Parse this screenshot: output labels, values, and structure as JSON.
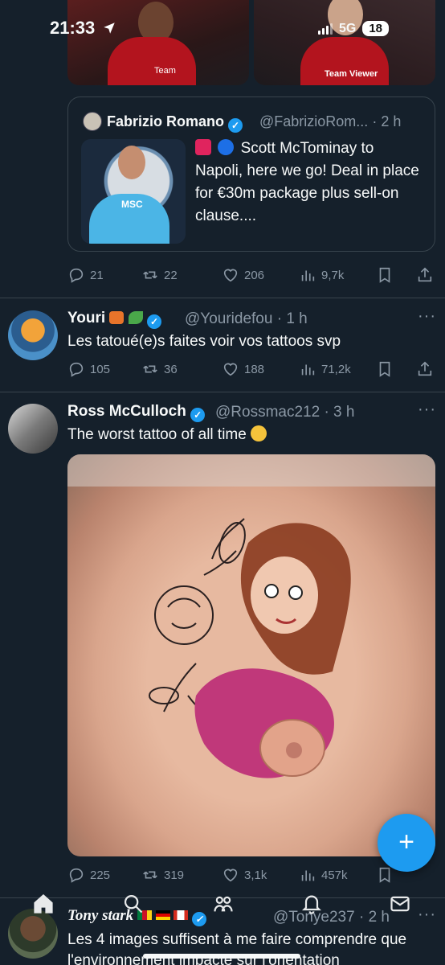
{
  "status_bar": {
    "time": "21:33",
    "network": "5G",
    "battery": "18"
  },
  "quoted_tweet": {
    "name": "Fabrizio Romano",
    "handle": "@FabrizioRom...",
    "age": "· 2 h",
    "text": "Scott McTominay to Napoli, here we go! Deal in place for €30m package plus sell-on clause....",
    "thumbnail_text": "MSC"
  },
  "top_photo_text": {
    "left_sponsor": "Team",
    "right_sponsor": "Team Viewer"
  },
  "tweet1_actions": {
    "replies": "21",
    "retweets": "22",
    "likes": "206",
    "views": "9,7k"
  },
  "tweet2": {
    "name": "Youri",
    "handle": "@Youridefou",
    "age": "· 1 h",
    "text": "Les tatoué(e)s faites voir vos tattoos svp",
    "actions": {
      "replies": "105",
      "retweets": "36",
      "likes": "188",
      "views": "71,2k"
    }
  },
  "tweet3": {
    "name": "Ross McCulloch",
    "handle": "@Rossmac212",
    "age": "· 3 h",
    "text": "The worst tattoo of all time",
    "actions": {
      "replies": "225",
      "retweets": "319",
      "likes": "3,1k",
      "views": "457k"
    }
  },
  "tweet4": {
    "name": "Tony stark",
    "handle": "@Tonye237",
    "age": "· 2 h",
    "text_line1": "Les 4 images suffisent à me faire comprendre que",
    "text_line2": "l'environnement impacte sur l'orientation"
  },
  "fab_label": "+",
  "colors": {
    "background": "#15202b",
    "accent": "#1d9bf0",
    "muted": "#8b98a5",
    "divider": "#38444d"
  },
  "icons": [
    "location-arrow-icon",
    "signal-icon",
    "verified-badge-icon",
    "reply-icon",
    "retweet-icon",
    "like-icon",
    "views-icon",
    "bookmark-icon",
    "share-icon",
    "more-icon",
    "home-icon",
    "search-icon",
    "communities-icon",
    "notifications-icon",
    "messages-icon"
  ]
}
